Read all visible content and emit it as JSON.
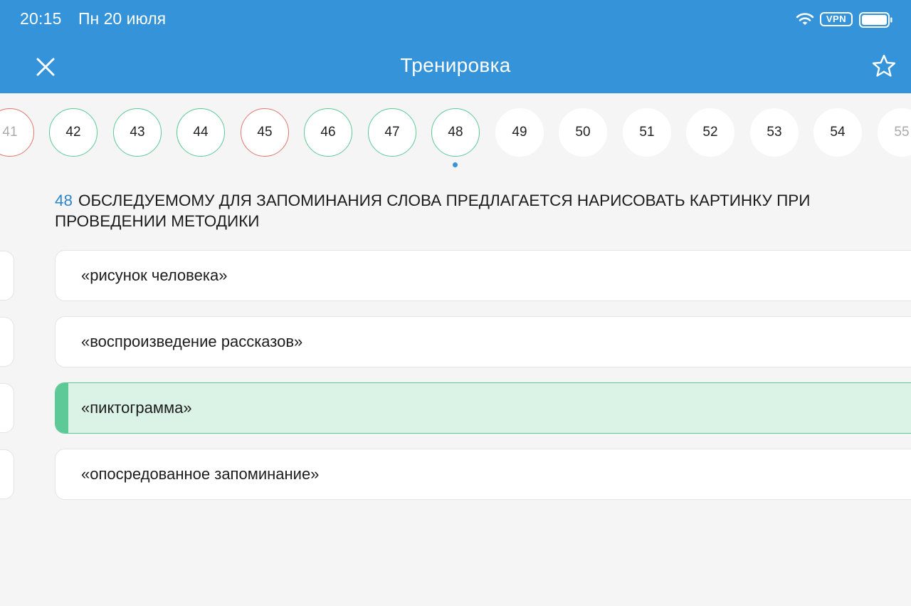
{
  "status_bar": {
    "time": "20:15",
    "date": "Пн 20 июля",
    "vpn_label": "VPN",
    "icons": [
      "wifi-icon",
      "battery-icon"
    ]
  },
  "header": {
    "title": "Тренировка",
    "close_icon": "close-icon",
    "favorite_icon": "star-icon"
  },
  "question_strip": {
    "items": [
      {
        "label": "41",
        "state": "wrong"
      },
      {
        "label": "42",
        "state": "correct"
      },
      {
        "label": "43",
        "state": "correct"
      },
      {
        "label": "44",
        "state": "correct"
      },
      {
        "label": "45",
        "state": "wrong"
      },
      {
        "label": "46",
        "state": "correct"
      },
      {
        "label": "47",
        "state": "correct"
      },
      {
        "label": "48",
        "state": "correct",
        "current": true
      },
      {
        "label": "49",
        "state": "unanswered"
      },
      {
        "label": "50",
        "state": "unanswered"
      },
      {
        "label": "51",
        "state": "unanswered"
      },
      {
        "label": "52",
        "state": "unanswered"
      },
      {
        "label": "53",
        "state": "unanswered"
      },
      {
        "label": "54",
        "state": "unanswered"
      },
      {
        "label": "55",
        "state": "unanswered"
      }
    ]
  },
  "question": {
    "number": "48",
    "text": "ОБСЛЕДУЕМОМУ ДЛЯ ЗАПОМИНАНИЯ СЛОВА ПРЕДЛАГАЕТСЯ НАРИСОВАТЬ КАРТИНКУ ПРИ ПРОВЕДЕНИИ МЕТОДИКИ"
  },
  "answers": [
    {
      "text": "«рисунок человека»",
      "selected": false
    },
    {
      "text": "«воспроизведение рассказов»",
      "selected": false
    },
    {
      "text": "«пиктограмма»",
      "selected": true
    },
    {
      "text": "«опосредованное запоминание»",
      "selected": false
    }
  ],
  "colors": {
    "header_bg": "#3493d9",
    "correct": "#5cc996",
    "wrong": "#e0766d",
    "selected_bg": "#daf3e6",
    "question_number": "#2f86c9"
  }
}
